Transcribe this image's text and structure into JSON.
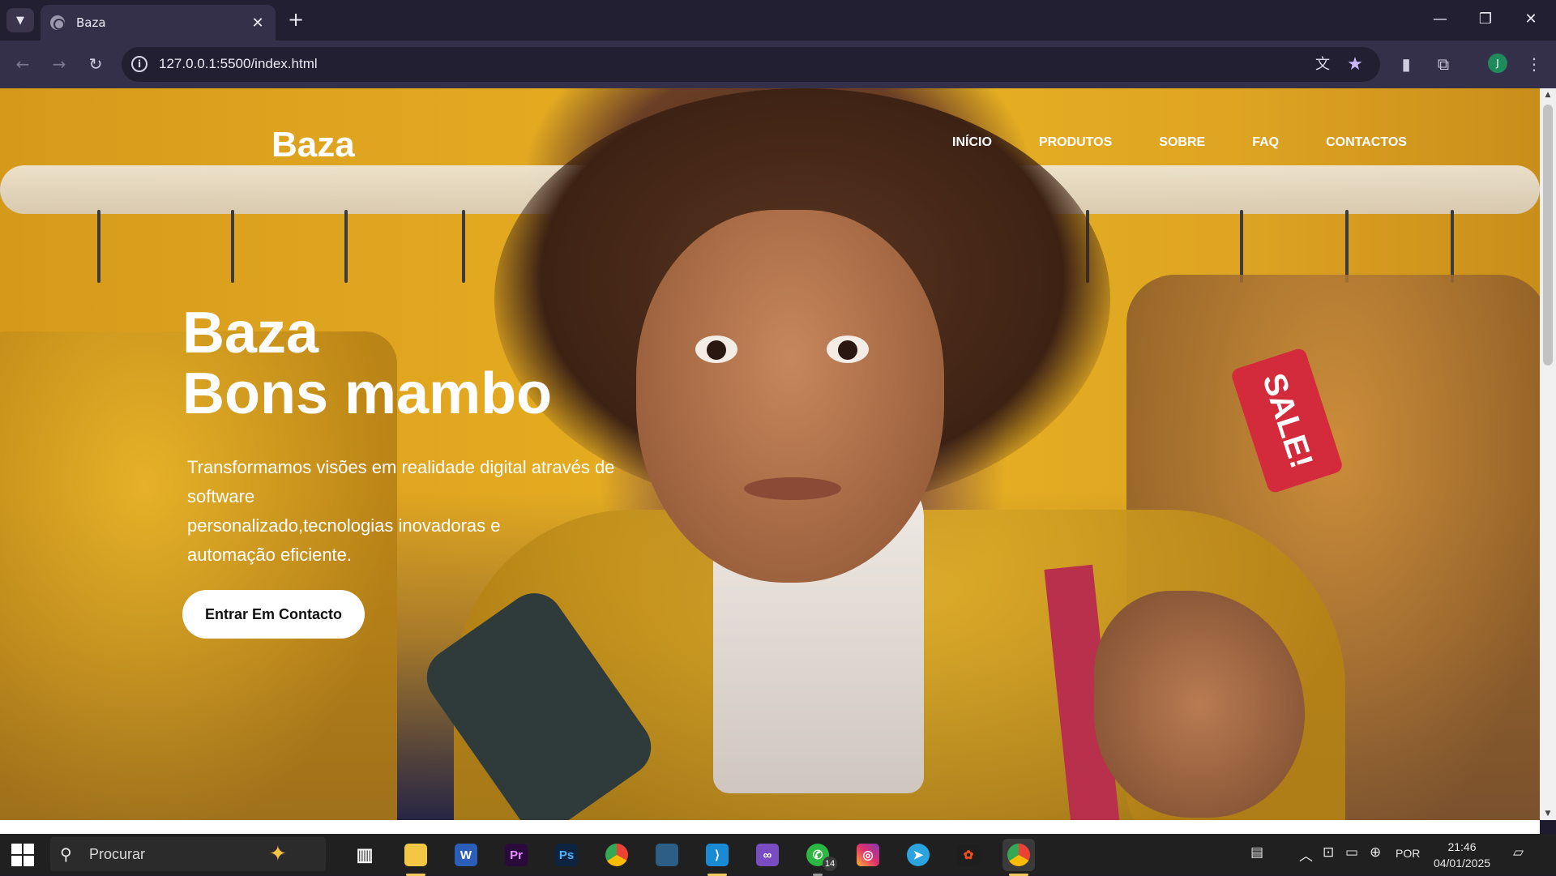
{
  "browser": {
    "tab_title": "Baza",
    "url": "127.0.0.1:5500/index.html",
    "profile_initial": "J"
  },
  "site": {
    "logo": "Baza",
    "nav": [
      "INÍCIO",
      "PRODUTOS",
      "SOBRE",
      "FAQ",
      "CONTACTOS"
    ],
    "hero_title_line1": "Baza",
    "hero_title_line2": "Bons mambo",
    "hero_sub_lines": [
      "Transformamos visões em realidade digital através de",
      "software",
      "personalizado,tecnologias inovadoras e",
      "automação eficiente."
    ],
    "cta_label": "Entrar Em Contacto",
    "sale_tag": "SALE!"
  },
  "taskbar": {
    "search_placeholder": "Procurar",
    "whatsapp_badge": "14",
    "language": "POR",
    "time": "21:46",
    "date": "04/01/2025"
  },
  "colors": {
    "chrome_dark": "#231f33",
    "chrome_toolbar": "#35304a",
    "hero_yellow": "#e0a520",
    "sale_red": "#d32b3b",
    "taskbar": "#202020"
  }
}
